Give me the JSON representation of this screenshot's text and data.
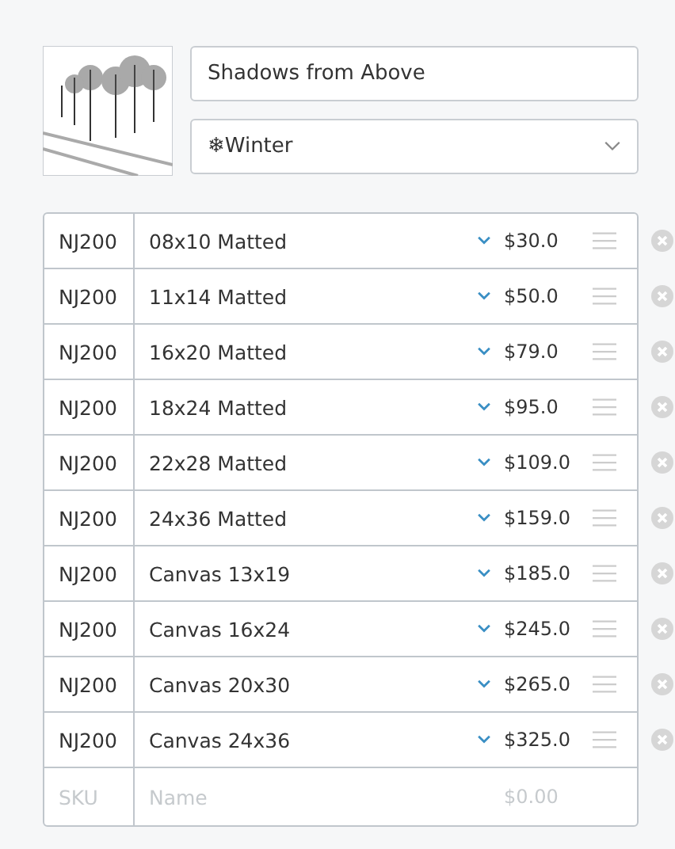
{
  "artwork": {
    "title": "Shadows from Above",
    "category": "❄Winter"
  },
  "variants": [
    {
      "sku": "NJ200",
      "name": "08x10 Matted",
      "price": "$30.0"
    },
    {
      "sku": "NJ200",
      "name": "11x14 Matted",
      "price": "$50.0"
    },
    {
      "sku": "NJ200",
      "name": "16x20 Matted",
      "price": "$79.0"
    },
    {
      "sku": "NJ200",
      "name": "18x24 Matted",
      "price": "$95.0"
    },
    {
      "sku": "NJ200",
      "name": "22x28 Matted",
      "price": "$109.0"
    },
    {
      "sku": "NJ200",
      "name": "24x36 Matted",
      "price": "$159.0"
    },
    {
      "sku": "NJ200",
      "name": "Canvas 13x19",
      "price": "$185.0"
    },
    {
      "sku": "NJ200",
      "name": "Canvas 16x24",
      "price": "$245.0"
    },
    {
      "sku": "NJ200",
      "name": "Canvas 20x30",
      "price": "$265.0"
    },
    {
      "sku": "NJ200",
      "name": "Canvas 24x36",
      "price": "$325.0"
    }
  ],
  "new_row": {
    "sku": {
      "placeholder": "SKU"
    },
    "name": {
      "placeholder": "Name"
    },
    "price": {
      "placeholder": "$0.00"
    }
  }
}
